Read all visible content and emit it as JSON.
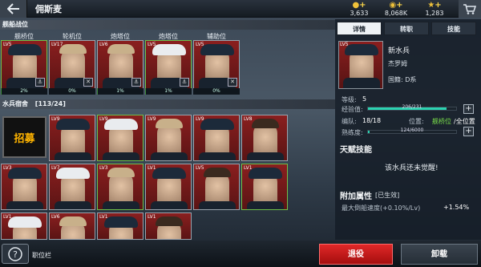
{
  "header": {
    "title": "佣斯麦",
    "back_icon": "back-arrow-icon",
    "cart_icon": "shop-cart-icon"
  },
  "resources": [
    {
      "icon": "coin-stack-icon",
      "value": "3,633"
    },
    {
      "icon": "gold-coin-icon",
      "value": "8,068K"
    },
    {
      "icon": "star-icon",
      "value": "1,283"
    }
  ],
  "battle_positions": {
    "header": "舰船战位",
    "slots": [
      {
        "label": "舰桥位",
        "level": "LV5",
        "percent": "2%",
        "progress": 0.02
      },
      {
        "label": "轮机位",
        "level": "LV17",
        "percent": "0%",
        "progress": 0
      },
      {
        "label": "炮塔位",
        "level": "LV6",
        "percent": "1%",
        "progress": 0.01
      },
      {
        "label": "炮塔位",
        "level": "LV5",
        "percent": "1%",
        "progress": 0.01
      },
      {
        "label": "辅助位",
        "level": "LV5",
        "percent": "0%",
        "progress": 0
      }
    ]
  },
  "sailor_list": {
    "header": "水兵宿舍",
    "count": "[113/24]",
    "recruit_label": "招募",
    "levels": [
      "LV9",
      "LV9",
      "LV9",
      "LV9",
      "LV8",
      "LV3",
      "LV7",
      "LV3",
      "LV1",
      "LV5",
      "LV1",
      "LV1",
      "LV6",
      "LV1",
      "LV1",
      "LV1"
    ]
  },
  "detail": {
    "tabs": [
      "详情",
      "转职",
      "技能"
    ],
    "active_tab": "详情",
    "name": "新水兵",
    "portrait_level": "LV5",
    "subname": "杰罗姆",
    "nationality": "国籍: D系",
    "level_label": "等级:",
    "level_value": "5",
    "exp_label": "经验值:",
    "exp_text": "206/231",
    "exp_progress": 0.89,
    "fleet_label": "编队:",
    "fleet_value": "18/18",
    "position_label": "位置:",
    "position_value": "舰桥位",
    "position_suffix": "/全位置",
    "skill_label": "熟练度:",
    "skill_text": "124/6000",
    "skill_progress": 0.02,
    "talent_header": "天赋技能",
    "talent_text": "该水兵还未觉醒!",
    "attr_header": "附加属性",
    "attr_tag": "[已生效]",
    "attr_name": "最大倒船速度(+0.10%/Lv)",
    "attr_value": "+1.54%"
  },
  "footer": {
    "help_icon": "help-icon",
    "help_text": "职位栏",
    "retire_label": "退役",
    "unequip_label": "卸载"
  },
  "colors": {
    "accent_red": "#d01c1c",
    "progress_green": "#3c8b3a",
    "exp_teal": "#2bd3b1",
    "position_green": "#7be04a",
    "gold": "#ffb400"
  }
}
